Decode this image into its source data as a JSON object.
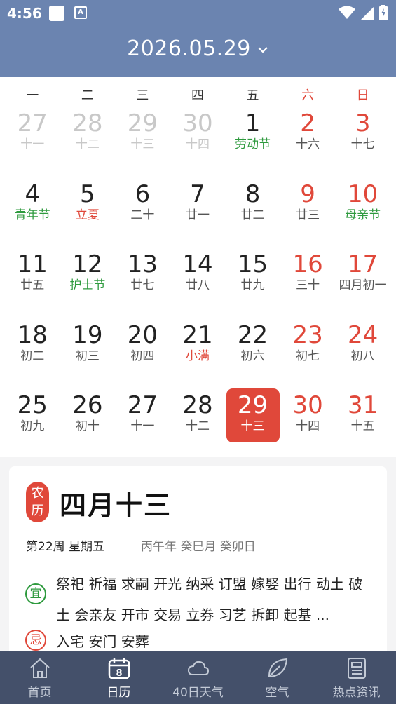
{
  "status_bar": {
    "time": "4:56",
    "a_icon": "A"
  },
  "header": {
    "date": "2026.05.29"
  },
  "weekdays": [
    {
      "label": "一",
      "weekend": false
    },
    {
      "label": "二",
      "weekend": false
    },
    {
      "label": "三",
      "weekend": false
    },
    {
      "label": "四",
      "weekend": false
    },
    {
      "label": "五",
      "weekend": false
    },
    {
      "label": "六",
      "weekend": true
    },
    {
      "label": "日",
      "weekend": true
    }
  ],
  "days": [
    {
      "n": "27",
      "l": "十一",
      "other": true
    },
    {
      "n": "28",
      "l": "十二",
      "other": true
    },
    {
      "n": "29",
      "l": "十三",
      "other": true
    },
    {
      "n": "30",
      "l": "十四",
      "other": true
    },
    {
      "n": "1",
      "l": "劳动节",
      "fest": true
    },
    {
      "n": "2",
      "l": "十六",
      "weekend": true
    },
    {
      "n": "3",
      "l": "十七",
      "weekend": true
    },
    {
      "n": "4",
      "l": "青年节",
      "fest": true
    },
    {
      "n": "5",
      "l": "立夏",
      "term": true
    },
    {
      "n": "6",
      "l": "二十"
    },
    {
      "n": "7",
      "l": "廿一"
    },
    {
      "n": "8",
      "l": "廿二"
    },
    {
      "n": "9",
      "l": "廿三",
      "weekend": true
    },
    {
      "n": "10",
      "l": "母亲节",
      "weekend": true,
      "fest": true
    },
    {
      "n": "11",
      "l": "廿五"
    },
    {
      "n": "12",
      "l": "护士节",
      "fest": true
    },
    {
      "n": "13",
      "l": "廿七"
    },
    {
      "n": "14",
      "l": "廿八"
    },
    {
      "n": "15",
      "l": "廿九"
    },
    {
      "n": "16",
      "l": "三十",
      "weekend": true
    },
    {
      "n": "17",
      "l": "四月初一",
      "weekend": true
    },
    {
      "n": "18",
      "l": "初二"
    },
    {
      "n": "19",
      "l": "初三"
    },
    {
      "n": "20",
      "l": "初四"
    },
    {
      "n": "21",
      "l": "小满",
      "term": true
    },
    {
      "n": "22",
      "l": "初六"
    },
    {
      "n": "23",
      "l": "初七",
      "weekend": true
    },
    {
      "n": "24",
      "l": "初八",
      "weekend": true
    },
    {
      "n": "25",
      "l": "初九"
    },
    {
      "n": "26",
      "l": "初十"
    },
    {
      "n": "27",
      "l": "十一"
    },
    {
      "n": "28",
      "l": "十二"
    },
    {
      "n": "29",
      "l": "十三",
      "selected": true
    },
    {
      "n": "30",
      "l": "十四",
      "weekend": true
    },
    {
      "n": "31",
      "l": "十五",
      "weekend": true
    }
  ],
  "lunar_card": {
    "badge_top": "农",
    "badge_bottom": "历",
    "lunar_date": "四月十三",
    "week_info": "第22周 星期五",
    "ganzhi": "丙午年 癸巳月 癸卯日",
    "yi_label": "宜",
    "yi_text": "祭祀 祈福 求嗣 开光 纳采 订盟 嫁娶 出行 动土 破土 会亲友 开市 交易 立券 习艺 拆卸 起基 ...",
    "ji_label": "忌",
    "ji_text": "入宅 安门 安葬"
  },
  "bottom_nav": [
    {
      "label": "首页",
      "icon": "home-icon",
      "active": false
    },
    {
      "label": "日历",
      "icon": "calendar-icon",
      "active": true,
      "icon_text": "8"
    },
    {
      "label": "40日天气",
      "icon": "cloud-icon",
      "active": false
    },
    {
      "label": "空气",
      "icon": "leaf-icon",
      "active": false
    },
    {
      "label": "热点资讯",
      "icon": "news-icon",
      "active": false
    }
  ],
  "colors": {
    "header": "#6b84b0",
    "accent_red": "#e0483a",
    "festival_green": "#2e9a3e",
    "nav_bg": "#44506a"
  }
}
